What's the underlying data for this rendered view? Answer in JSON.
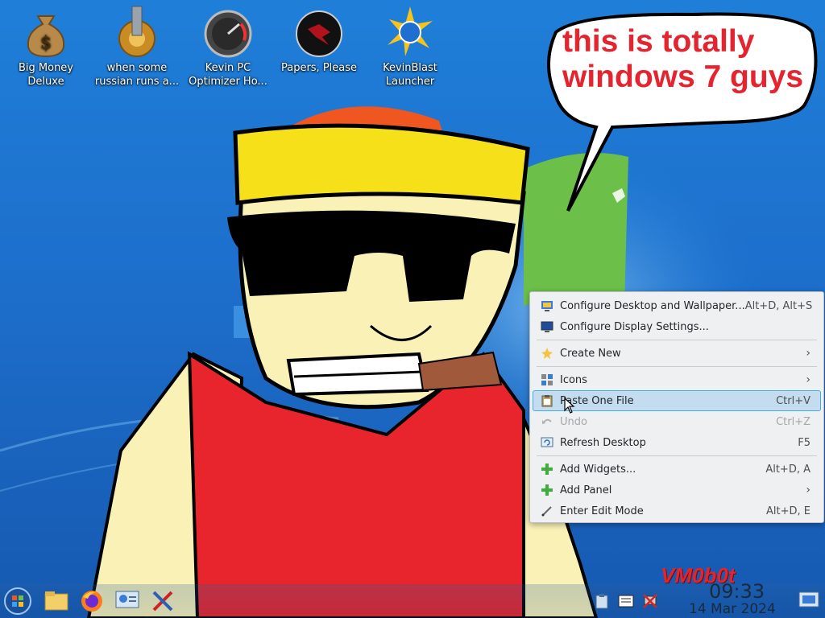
{
  "desktop_icons": [
    {
      "label": "Big Money\nDeluxe",
      "icon": "money-bag-icon"
    },
    {
      "label": "when some\nrussian runs a...",
      "icon": "gear-icon"
    },
    {
      "label": "Kevin PC\nOptimizer Ho...",
      "icon": "speedometer-icon"
    },
    {
      "label": "Papers, Please",
      "icon": "papers-please-icon"
    },
    {
      "label": "KevinBlast\nLauncher",
      "icon": "launcher-icon"
    }
  ],
  "speech_bubble": {
    "text": "this is totally windows 7 guys"
  },
  "context_menu": {
    "items": [
      {
        "label": "Configure Desktop and Wallpaper...",
        "shortcut": "Alt+D, Alt+S",
        "icon": "desktop-config-icon"
      },
      {
        "label": "Configure Display Settings...",
        "shortcut": "",
        "icon": "display-icon"
      },
      {
        "label": "Create New",
        "shortcut": "",
        "icon": "new-icon",
        "submenu": true
      },
      {
        "label": "Icons",
        "shortcut": "",
        "icon": "icons-icon",
        "submenu": true
      },
      {
        "label": "Paste One File",
        "shortcut": "Ctrl+V",
        "icon": "paste-icon",
        "active": true
      },
      {
        "label": "Undo",
        "shortcut": "Ctrl+Z",
        "icon": "undo-icon",
        "disabled": true
      },
      {
        "label": "Refresh Desktop",
        "shortcut": "F5",
        "icon": "refresh-icon"
      },
      {
        "label": "Add Widgets...",
        "shortcut": "Alt+D, A",
        "icon": "add-icon"
      },
      {
        "label": "Add Panel",
        "shortcut": "",
        "icon": "add-icon",
        "submenu": true
      },
      {
        "label": "Enter Edit Mode",
        "shortcut": "Alt+D, E",
        "icon": "edit-icon"
      }
    ]
  },
  "taskbar": {
    "clock_time": "09:33",
    "clock_date": "14 Mar 2024",
    "watermark": "VM0b0t",
    "launchers": [
      "start-orb-icon",
      "file-manager-icon",
      "firefox-icon",
      "system-settings-icon",
      "tools-icon"
    ],
    "tray": [
      "clipboard-icon",
      "notes-icon",
      "network-icon",
      "show-desktop-icon"
    ]
  },
  "colors": {
    "menu_highlight": "#c4dcf0",
    "menu_highlight_border": "#3daee9",
    "bubble_text": "#e4252f"
  }
}
